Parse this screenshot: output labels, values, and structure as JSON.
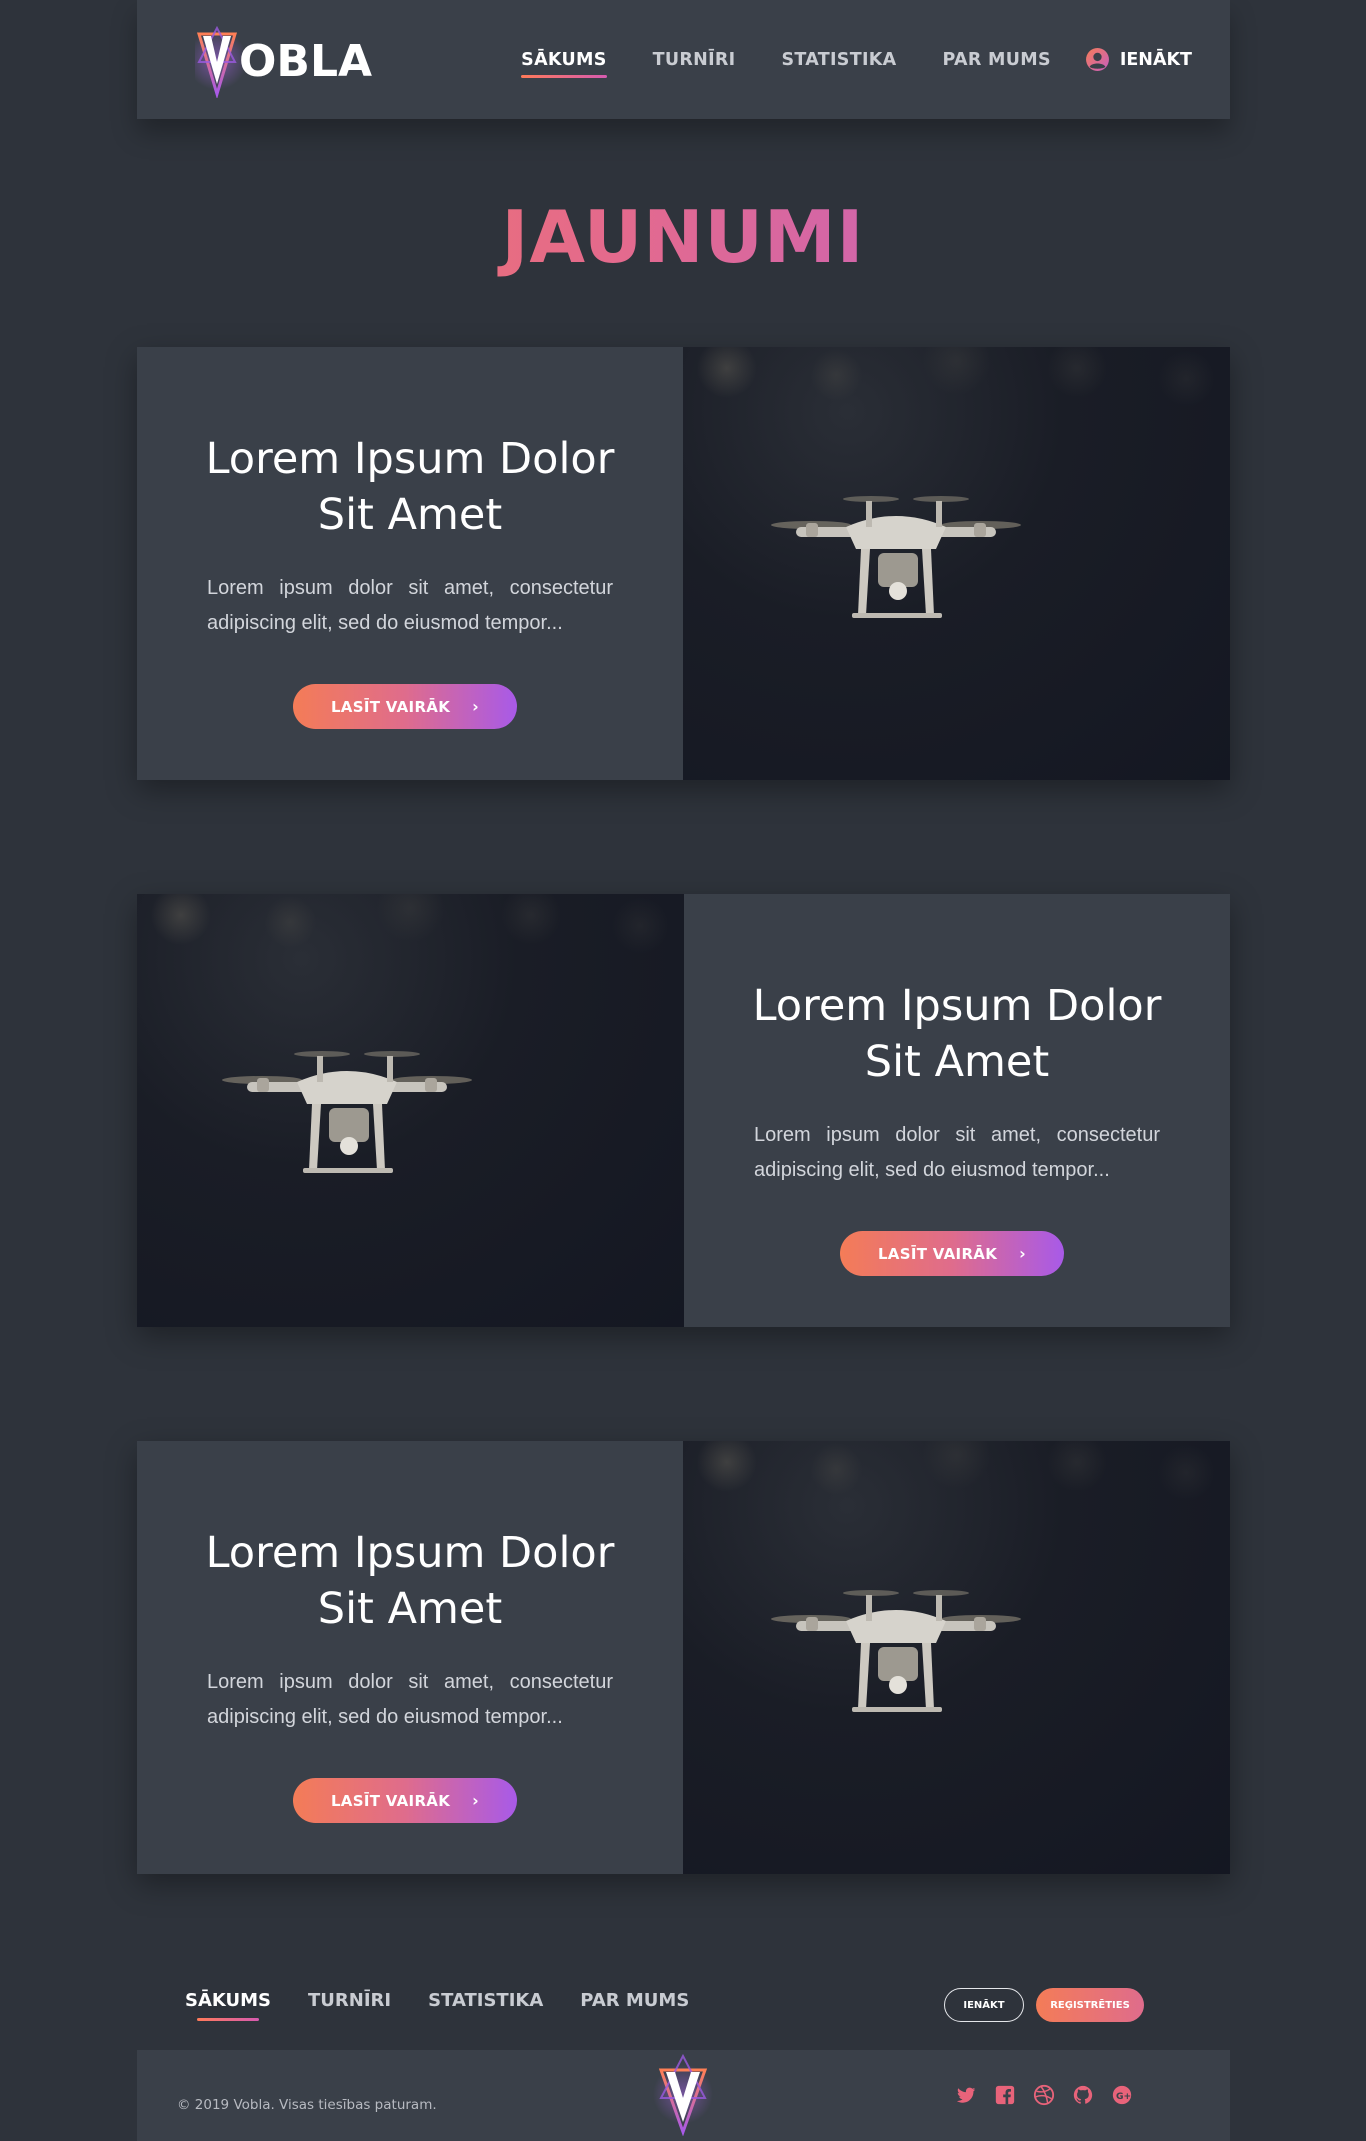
{
  "brand": {
    "name": "OBLA",
    "initial": "V"
  },
  "nav": {
    "items": [
      {
        "label": "SĀKUMS",
        "active": true
      },
      {
        "label": "TURNĪRI",
        "active": false
      },
      {
        "label": "STATISTIKA",
        "active": false
      },
      {
        "label": "PAR MUMS",
        "active": false
      }
    ],
    "login_label": "IENĀKT",
    "login_icon": "user-circle-icon"
  },
  "page_title": "JAUNUMI",
  "cards": [
    {
      "title": "Lorem Ipsum Dolor Sit Amet",
      "description": "Lorem ipsum dolor sit amet, consectetur adipiscing elit, sed do eiusmod tempor...",
      "button_label": "LASĪT VAIRĀK",
      "image_side": "right"
    },
    {
      "title": "Lorem Ipsum Dolor Sit Amet",
      "description": "Lorem ipsum dolor sit amet, consectetur adipiscing elit, sed do eiusmod tempor...",
      "button_label": "LASĪT VAIRĀK",
      "image_side": "left"
    },
    {
      "title": "Lorem Ipsum Dolor Sit Amet",
      "description": "Lorem ipsum dolor sit amet, consectetur adipiscing elit, sed do eiusmod tempor...",
      "button_label": "LASĪT VAIRĀK",
      "image_side": "right"
    }
  ],
  "footer": {
    "nav": [
      {
        "label": "SĀKUMS",
        "active": true
      },
      {
        "label": "TURNĪRI",
        "active": false
      },
      {
        "label": "STATISTIKA",
        "active": false
      },
      {
        "label": "PAR MUMS",
        "active": false
      }
    ],
    "login_label": "IENĀKT",
    "register_label": "REĢISTRĒTIES",
    "copyright": "© 2019 Vobla. Visas tiesības paturam.",
    "social": [
      "twitter-icon",
      "facebook-icon",
      "dribbble-icon",
      "github-icon",
      "google-plus-icon"
    ]
  },
  "colors": {
    "background": "#2e333b",
    "panel": "#3a4049",
    "accent_start": "#f47c57",
    "accent_mid": "#df6c8c",
    "accent_end": "#a85ae8"
  }
}
